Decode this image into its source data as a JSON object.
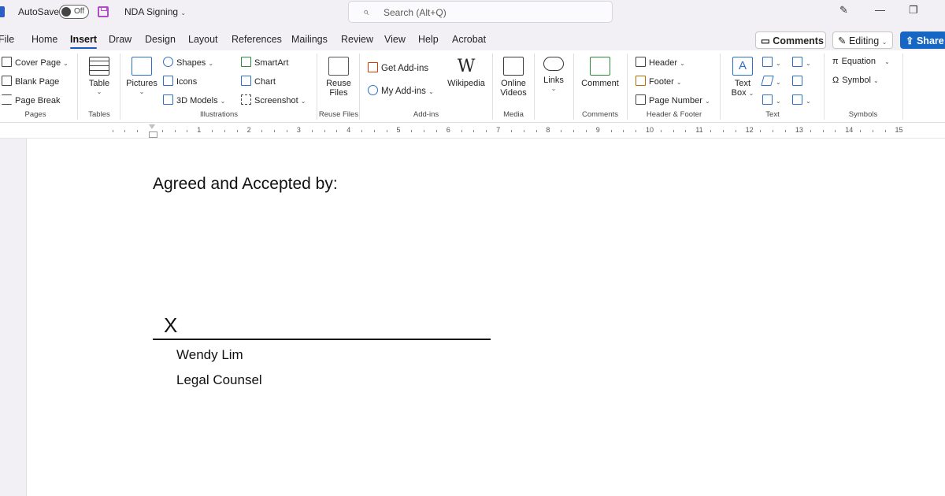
{
  "titlebar": {
    "autosave_label": "AutoSave",
    "autosave_state": "Off",
    "doc_title": "NDA Signing",
    "search_placeholder": "Search (Alt+Q)"
  },
  "tabs": [
    "File",
    "Home",
    "Insert",
    "Draw",
    "Design",
    "Layout",
    "References",
    "Mailings",
    "Review",
    "View",
    "Help",
    "Acrobat"
  ],
  "active_tab": "Insert",
  "actions": {
    "comments": "Comments",
    "editing": "Editing",
    "share": "Share"
  },
  "ribbon": {
    "pages": {
      "cover_page": "Cover Page",
      "blank_page": "Blank Page",
      "page_break": "Page Break",
      "group": "Pages"
    },
    "tables": {
      "table": "Table",
      "group": "Tables"
    },
    "illustrations": {
      "pictures": "Pictures",
      "shapes": "Shapes",
      "icons": "Icons",
      "models": "3D Models",
      "smartart": "SmartArt",
      "chart": "Chart",
      "screenshot": "Screenshot",
      "group": "Illustrations"
    },
    "reuse": {
      "reuse_line1": "Reuse",
      "reuse_line2": "Files",
      "group": "Reuse Files"
    },
    "addins": {
      "get_addins": "Get Add-ins",
      "my_addins": "My Add-ins",
      "wikipedia": "Wikipedia",
      "group": "Add-ins"
    },
    "media": {
      "online_line1": "Online",
      "online_line2": "Videos",
      "group": "Media"
    },
    "links": {
      "links": "Links"
    },
    "comments": {
      "comment": "Comment",
      "group": "Comments"
    },
    "header_footer": {
      "header": "Header",
      "footer": "Footer",
      "page_number": "Page Number",
      "group": "Header & Footer"
    },
    "text": {
      "textbox_line1": "Text",
      "textbox_line2": "Box",
      "group": "Text"
    },
    "symbols": {
      "equation": "Equation",
      "symbol": "Symbol",
      "group": "Symbols"
    }
  },
  "ruler": [
    "1",
    "2",
    "3",
    "4",
    "5",
    "6",
    "7",
    "8",
    "9",
    "10",
    "11",
    "12",
    "13",
    "14",
    "15"
  ],
  "document": {
    "heading": "Agreed and Accepted by:",
    "signature_mark": "X",
    "signer_name": "Wendy Lim",
    "signer_title": "Legal Counsel"
  }
}
